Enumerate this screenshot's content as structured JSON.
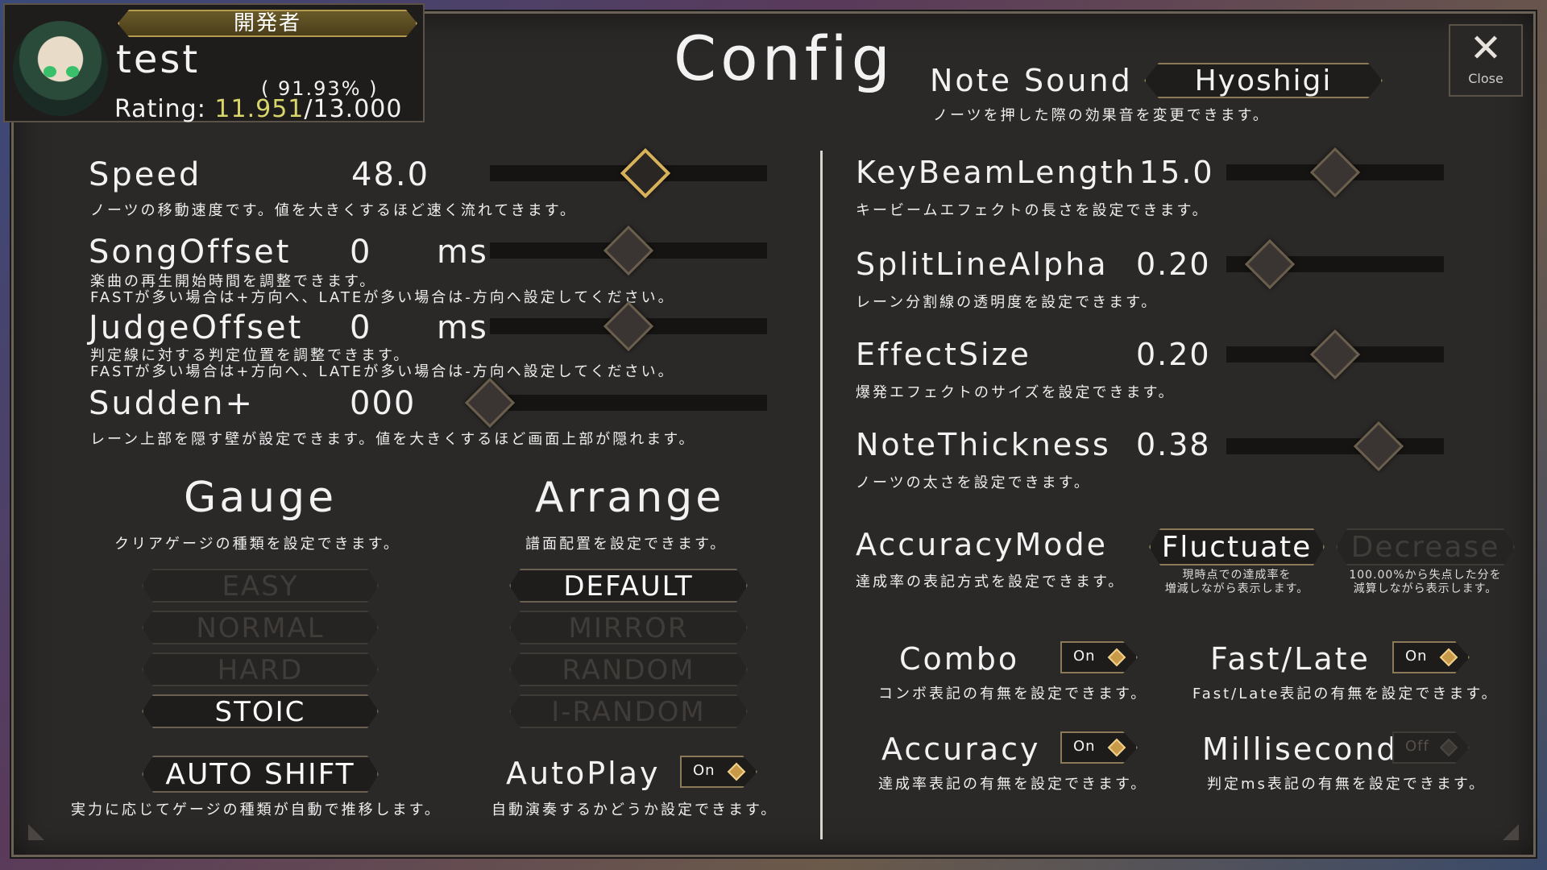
{
  "player": {
    "rank": "開発者",
    "name": "test",
    "accuracy": "( 91.93% )",
    "rating_label": "Rating:",
    "rating_current": "11.951",
    "rating_max": "/13.000"
  },
  "title": "Config",
  "close": {
    "icon": "close-icon",
    "label": "Close"
  },
  "note_sound": {
    "label": "Note Sound",
    "value": "Hyoshigi",
    "desc": "ノーツを押した際の効果音を変更できます。"
  },
  "left_sliders": {
    "speed": {
      "label": "Speed",
      "value": "48.0",
      "unit": "",
      "level": 0.56,
      "desc": "ノーツの移動速度です。値を大きくするほど速く流れてきます。"
    },
    "song_offset": {
      "label": "SongOffset",
      "value": "0",
      "unit": "ms",
      "level": 0.5,
      "desc1": "楽曲の再生開始時間を調整できます。",
      "desc2": "FASTが多い場合は+方向へ、LATEが多い場合は-方向へ設定してください。"
    },
    "judge_offset": {
      "label": "JudgeOffset",
      "value": "0",
      "unit": "ms",
      "level": 0.5,
      "desc1": "判定線に対する判定位置を調整できます。",
      "desc2": "FASTが多い場合は+方向へ、LATEが多い場合は-方向へ設定してください。"
    },
    "sudden": {
      "label": "Sudden+",
      "value": "000",
      "level": 0.0,
      "desc": "レーン上部を隠す壁が設定できます。値を大きくするほど画面上部が隠れます。"
    }
  },
  "gauge": {
    "title": "Gauge",
    "desc": "クリアゲージの種類を設定できます。",
    "options": [
      {
        "label": "EASY",
        "selected": false
      },
      {
        "label": "NORMAL",
        "selected": false
      },
      {
        "label": "HARD",
        "selected": false
      },
      {
        "label": "STOIC",
        "selected": true
      }
    ],
    "auto_shift": {
      "label": "AUTO SHIFT",
      "desc": "実力に応じてゲージの種類が自動で推移します。"
    }
  },
  "arrange": {
    "title": "Arrange",
    "desc": "譜面配置を設定できます。",
    "options": [
      {
        "label": "DEFAULT",
        "selected": true
      },
      {
        "label": "MIRROR",
        "selected": false
      },
      {
        "label": "RANDOM",
        "selected": false
      },
      {
        "label": "I-RANDOM",
        "selected": false
      }
    ],
    "autoplay": {
      "label": "AutoPlay",
      "state": "On",
      "desc": "自動演奏するかどうか設定できます。"
    }
  },
  "right_sliders": {
    "key_beam": {
      "label": "KeyBeamLength",
      "value": "15.0",
      "level": 0.5,
      "desc": "キービームエフェクトの長さを設定できます。"
    },
    "split_line": {
      "label": "SplitLineAlpha",
      "value": "0.20",
      "level": 0.2,
      "desc": "レーン分割線の透明度を設定できます。"
    },
    "effect_size": {
      "label": "EffectSize",
      "value": "0.20",
      "level": 0.5,
      "desc": "爆発エフェクトのサイズを設定できます。"
    },
    "note_thickness": {
      "label": "NoteThickness",
      "value": "0.38",
      "level": 0.7,
      "desc": "ノーツの太さを設定できます。"
    }
  },
  "accuracy_mode": {
    "label": "AccuracyMode",
    "desc": "達成率の表記方式を設定できます。",
    "fluctuate": {
      "label": "Fluctuate",
      "desc1": "現時点での達成率を",
      "desc2": "増減しながら表示します。"
    },
    "decrease": {
      "label": "Decrease",
      "desc1": "100.00%から失点した分を",
      "desc2": "減算しながら表示します。"
    }
  },
  "toggles": {
    "combo": {
      "label": "Combo",
      "state": "On",
      "desc": "コンボ表記の有無を設定できます。"
    },
    "fast_late": {
      "label": "Fast/Late",
      "state": "On",
      "desc": "Fast/Late表記の有無を設定できます。"
    },
    "accuracy": {
      "label": "Accuracy",
      "state": "On",
      "desc": "達成率表記の有無を設定できます。"
    },
    "millisecond": {
      "label": "Millisecond",
      "state": "Off",
      "desc": "判定ms表記の有無を設定できます。"
    }
  }
}
